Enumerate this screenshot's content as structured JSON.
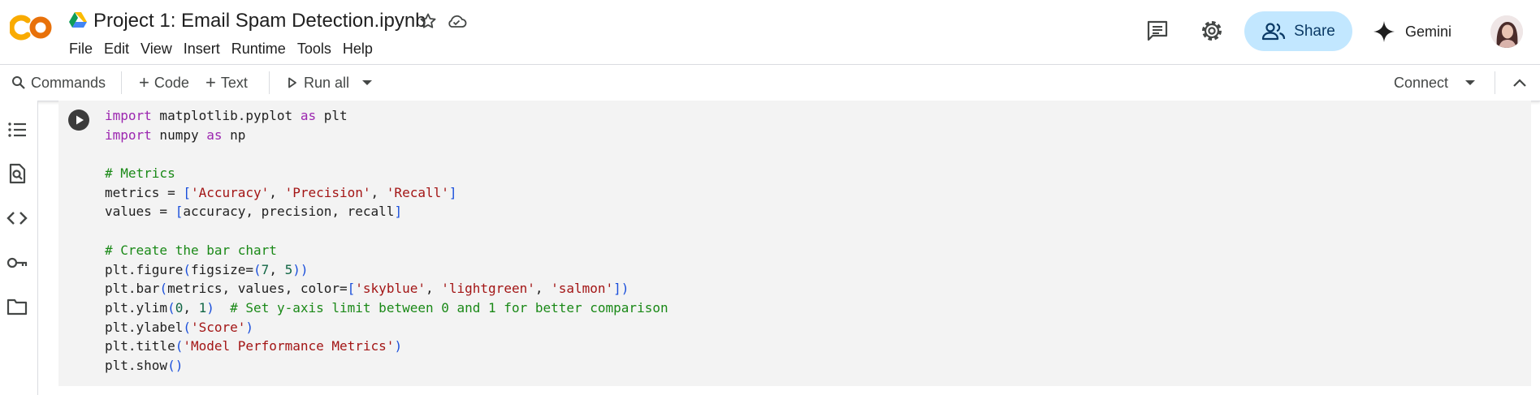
{
  "header": {
    "title": "Project 1: Email Spam Detection.ipynb",
    "logo_text": "CO",
    "menu": [
      "File",
      "Edit",
      "View",
      "Insert",
      "Runtime",
      "Tools",
      "Help"
    ],
    "share_label": "Share",
    "gemini_label": "Gemini"
  },
  "toolbar": {
    "commands_label": "Commands",
    "code_label": "Code",
    "text_label": "Text",
    "run_all_label": "Run all",
    "connect_label": "Connect"
  },
  "rail": {
    "icons": [
      "table-of-contents-icon",
      "find-replace-icon",
      "code-snippets-icon",
      "secrets-key-icon",
      "files-folder-icon"
    ]
  },
  "cell": {
    "lines": [
      [
        {
          "t": "kw",
          "v": "import"
        },
        {
          "t": "pl",
          "v": " matplotlib.pyplot "
        },
        {
          "t": "kw",
          "v": "as"
        },
        {
          "t": "pl",
          "v": " plt"
        }
      ],
      [
        {
          "t": "kw",
          "v": "import"
        },
        {
          "t": "pl",
          "v": " numpy "
        },
        {
          "t": "kw",
          "v": "as"
        },
        {
          "t": "pl",
          "v": " np"
        }
      ],
      [],
      [
        {
          "t": "cmt",
          "v": "# Metrics"
        }
      ],
      [
        {
          "t": "pl",
          "v": "metrics = "
        },
        {
          "t": "br",
          "v": "["
        },
        {
          "t": "str",
          "v": "'Accuracy'"
        },
        {
          "t": "pl",
          "v": ", "
        },
        {
          "t": "str",
          "v": "'Precision'"
        },
        {
          "t": "pl",
          "v": ", "
        },
        {
          "t": "str",
          "v": "'Recall'"
        },
        {
          "t": "br",
          "v": "]"
        }
      ],
      [
        {
          "t": "pl",
          "v": "values = "
        },
        {
          "t": "br",
          "v": "["
        },
        {
          "t": "pl",
          "v": "accuracy, precision, recall"
        },
        {
          "t": "br",
          "v": "]"
        }
      ],
      [],
      [
        {
          "t": "cmt",
          "v": "# Create the bar chart"
        }
      ],
      [
        {
          "t": "pl",
          "v": "plt.figure"
        },
        {
          "t": "br",
          "v": "("
        },
        {
          "t": "pl",
          "v": "figsize="
        },
        {
          "t": "br",
          "v": "("
        },
        {
          "t": "num",
          "v": "7"
        },
        {
          "t": "pl",
          "v": ", "
        },
        {
          "t": "num",
          "v": "5"
        },
        {
          "t": "br",
          "v": "))"
        }
      ],
      [
        {
          "t": "pl",
          "v": "plt.bar"
        },
        {
          "t": "br",
          "v": "("
        },
        {
          "t": "pl",
          "v": "metrics, values, color="
        },
        {
          "t": "br",
          "v": "["
        },
        {
          "t": "str",
          "v": "'skyblue'"
        },
        {
          "t": "pl",
          "v": ", "
        },
        {
          "t": "str",
          "v": "'lightgreen'"
        },
        {
          "t": "pl",
          "v": ", "
        },
        {
          "t": "str",
          "v": "'salmon'"
        },
        {
          "t": "br",
          "v": "])"
        }
      ],
      [
        {
          "t": "pl",
          "v": "plt.ylim"
        },
        {
          "t": "br",
          "v": "("
        },
        {
          "t": "num",
          "v": "0"
        },
        {
          "t": "pl",
          "v": ", "
        },
        {
          "t": "num",
          "v": "1"
        },
        {
          "t": "br",
          "v": ")"
        },
        {
          "t": "pl",
          "v": "  "
        },
        {
          "t": "cmt",
          "v": "# Set y-axis limit between 0 and 1 for better comparison"
        }
      ],
      [
        {
          "t": "pl",
          "v": "plt.ylabel"
        },
        {
          "t": "br",
          "v": "("
        },
        {
          "t": "str",
          "v": "'Score'"
        },
        {
          "t": "br",
          "v": ")"
        }
      ],
      [
        {
          "t": "pl",
          "v": "plt.title"
        },
        {
          "t": "br",
          "v": "("
        },
        {
          "t": "str",
          "v": "'Model Performance Metrics'"
        },
        {
          "t": "br",
          "v": ")"
        }
      ],
      [
        {
          "t": "pl",
          "v": "plt.show"
        },
        {
          "t": "br",
          "v": "()"
        }
      ]
    ]
  },
  "colors": {
    "share_bg": "#c2e7ff",
    "keyword": "#9c27b0",
    "string": "#a31515",
    "comment": "#1a8917",
    "number": "#116644",
    "bracket": "#1a4fdb",
    "cell_bg": "#f3f3f3"
  }
}
